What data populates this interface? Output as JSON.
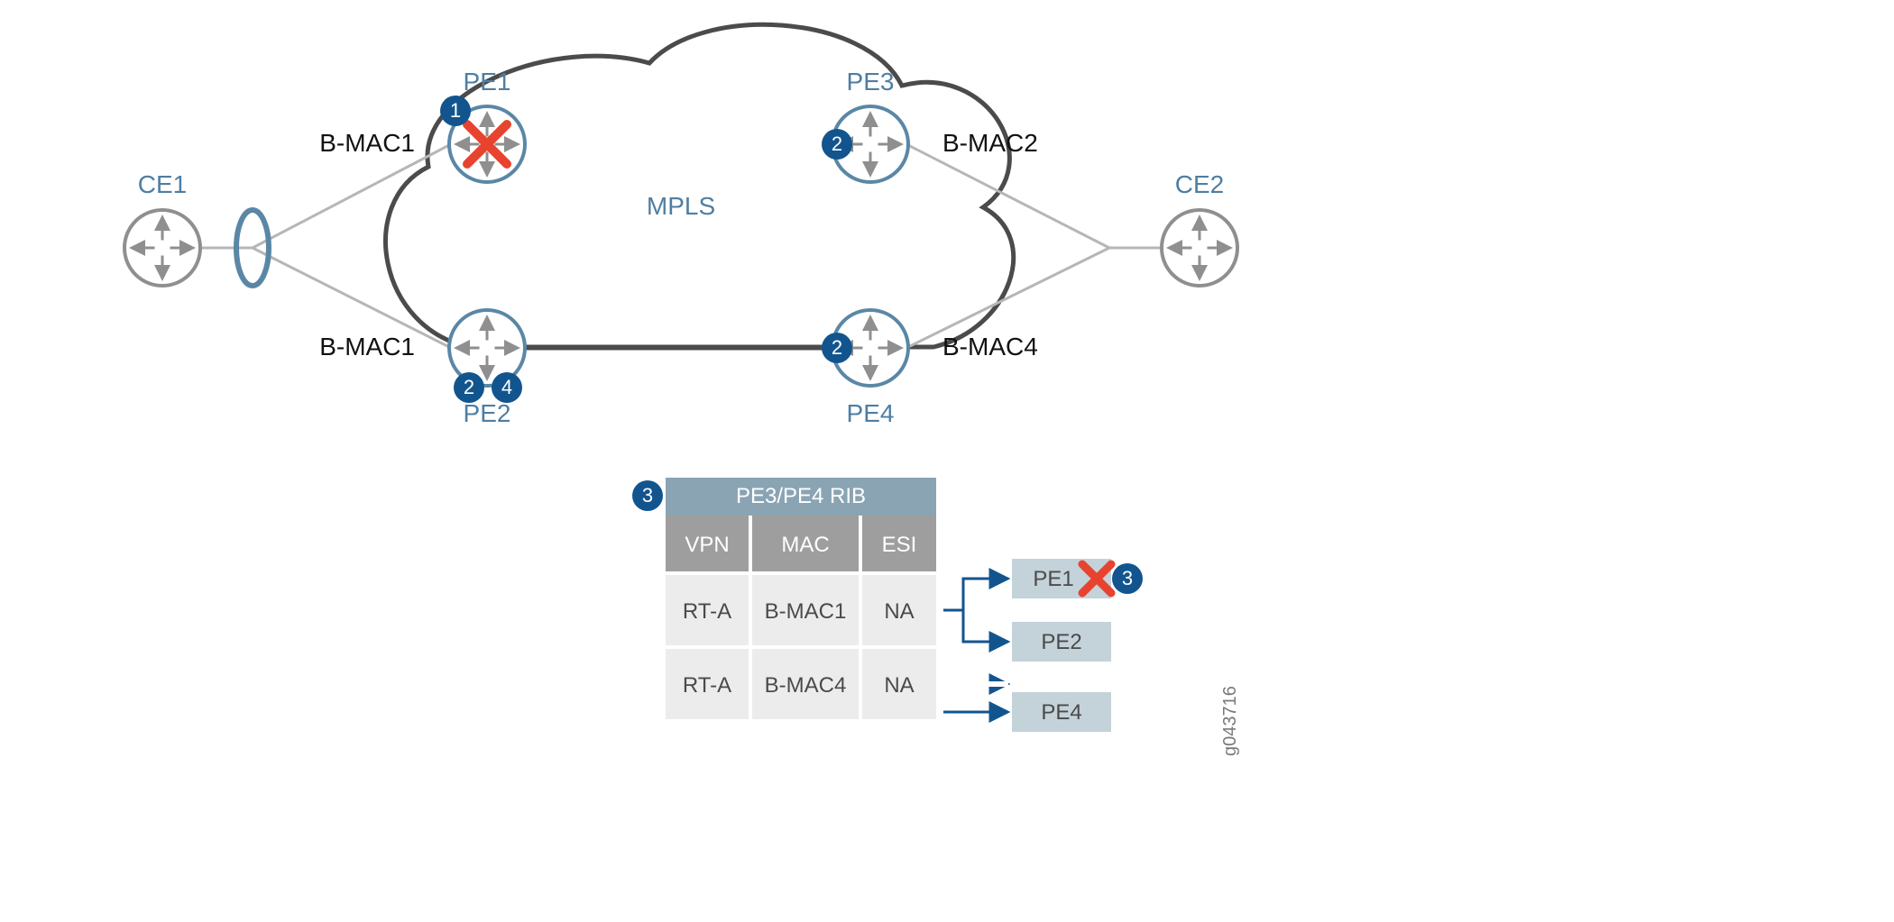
{
  "diagram_id": "g043716",
  "cloud_label": "MPLS",
  "routers": {
    "ce1": {
      "label": "CE1",
      "mac": ""
    },
    "ce2": {
      "label": "CE2",
      "mac": ""
    },
    "pe1": {
      "label": "PE1",
      "mac": "B-MAC1",
      "failed": true,
      "badges": [
        1
      ]
    },
    "pe2": {
      "label": "PE2",
      "mac": "B-MAC1",
      "failed": false,
      "badges": [
        2,
        4
      ]
    },
    "pe3": {
      "label": "PE3",
      "mac": "B-MAC2",
      "failed": false,
      "badges": [
        2
      ]
    },
    "pe4": {
      "label": "PE4",
      "mac": "B-MAC4",
      "failed": false,
      "badges": [
        2
      ]
    }
  },
  "rib": {
    "badge": 3,
    "title": "PE3/PE4 RIB",
    "headers": {
      "vpn": "VPN",
      "mac": "MAC",
      "esi": "ESI"
    },
    "rows": [
      {
        "vpn": "RT-A",
        "mac": "B-MAC1",
        "esi": "NA",
        "nexthops": [
          {
            "label": "PE1",
            "failed": true,
            "badge": 3
          },
          {
            "label": "PE2",
            "failed": false
          }
        ]
      },
      {
        "vpn": "RT-A",
        "mac": "B-MAC4",
        "esi": "NA",
        "nexthops": [
          {
            "label": "PE4",
            "failed": false
          }
        ]
      }
    ]
  }
}
